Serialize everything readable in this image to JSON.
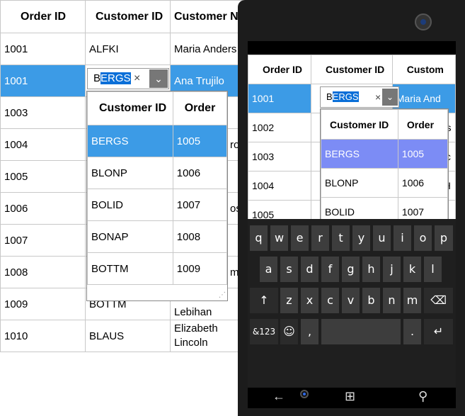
{
  "desktop": {
    "columns": [
      "Order ID",
      "Customer ID",
      "Customer Na"
    ],
    "rows": [
      {
        "order": "1001",
        "customer": "ALFKI",
        "name": "Maria Anders"
      },
      {
        "order": "1001",
        "customer": "",
        "name": "Ana Trujilo"
      },
      {
        "order": "1003",
        "customer": "",
        "name": ""
      },
      {
        "order": "1004",
        "customer": "",
        "name": "ro"
      },
      {
        "order": "1005",
        "customer": "",
        "name": ""
      },
      {
        "order": "1006",
        "customer": "",
        "name": "os"
      },
      {
        "order": "1007",
        "customer": "",
        "name": ""
      },
      {
        "order": "1008",
        "customer": "",
        "name": "m"
      },
      {
        "order": "1009",
        "customer": "BOTTM",
        "name": "Lebihan"
      },
      {
        "order": "1010",
        "customer": "BLAUS",
        "name": "Elizabeth Lincoln"
      }
    ],
    "editor": {
      "prefix": "B",
      "selected": "ERGS",
      "clear": "×",
      "drop": "⌄"
    },
    "popup": {
      "columns": [
        "Customer ID",
        "Order"
      ],
      "rows": [
        {
          "id": "BERGS",
          "order": "1005"
        },
        {
          "id": "BLONP",
          "order": "1006"
        },
        {
          "id": "BOLID",
          "order": "1007"
        },
        {
          "id": "BONAP",
          "order": "1008"
        },
        {
          "id": "BOTTM",
          "order": "1009"
        }
      ]
    }
  },
  "mobile": {
    "columns": [
      "Order ID",
      "Customer ID",
      "Custom"
    ],
    "rows": [
      {
        "order": "1001",
        "name": "Maria And"
      },
      {
        "order": "1002",
        "name": "es"
      },
      {
        "order": "1003",
        "name": "ic"
      },
      {
        "order": "1004",
        "name": "H"
      },
      {
        "order": "1005",
        "name": ""
      }
    ],
    "editor": {
      "prefix": "B",
      "selected": "ERGS",
      "clear": "×",
      "drop": "⌄"
    },
    "popup": {
      "columns": [
        "Customer ID",
        "Order"
      ],
      "rows": [
        {
          "id": "BERGS",
          "order": "1005"
        },
        {
          "id": "BLONP",
          "order": "1006"
        },
        {
          "id": "BOLID",
          "order": "1007"
        }
      ]
    },
    "keyboard": {
      "row1": [
        "q",
        "w",
        "e",
        "r",
        "t",
        "y",
        "u",
        "i",
        "o",
        "p"
      ],
      "row2": [
        "a",
        "s",
        "d",
        "f",
        "g",
        "h",
        "j",
        "k",
        "l"
      ],
      "row3": [
        "↑",
        "z",
        "x",
        "c",
        "v",
        "b",
        "n",
        "m",
        "⌫"
      ],
      "row4": [
        "&123",
        "☺",
        ",",
        "",
        ".",
        "↵"
      ]
    },
    "nav": {
      "back": "←",
      "windows": "⊞",
      "search": "⚲"
    }
  }
}
